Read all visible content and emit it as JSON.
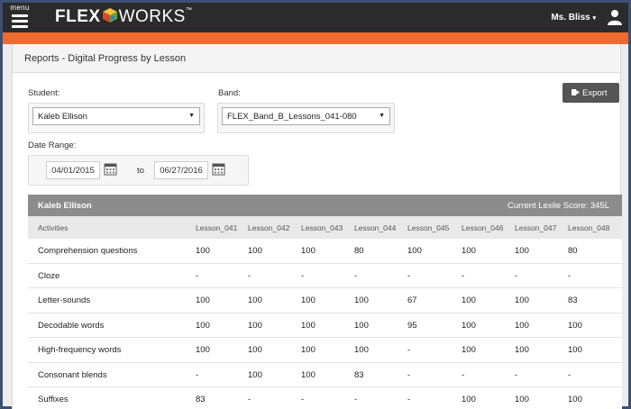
{
  "header": {
    "menu_label": "menu",
    "logo_flex": "FLEX",
    "logo_works": "WORKS",
    "logo_tm": "™",
    "user_name": "Ms. Bliss",
    "user_caret": "▾"
  },
  "page": {
    "title": "Reports - Digital Progress by Lesson"
  },
  "filters": {
    "student_label": "Student:",
    "student_value": "Kaleb Ellison",
    "band_label": "Band:",
    "band_value": "FLEX_Band_B_Lessons_041-080",
    "date_range_label": "Date Range:",
    "start_date": "04/01/2015",
    "to_label": "to",
    "end_date": "06/27/2016",
    "dropdown_arrow": "▼"
  },
  "toolbar": {
    "export_label": "Export"
  },
  "report": {
    "student_name": "Kaleb Ellison",
    "lexile": "Current Lexile Score: 345L",
    "columns": [
      "Activities",
      "Lesson_041",
      "Lesson_042",
      "Lesson_043",
      "Lesson_044",
      "Lesson_045",
      "Lesson_046",
      "Lesson_047",
      "Lesson_048"
    ],
    "rows": [
      {
        "activity": "Comprehension questions",
        "values": [
          "100",
          "100",
          "100",
          "80",
          "100",
          "100",
          "100",
          "80"
        ]
      },
      {
        "activity": "Cloze",
        "values": [
          "-",
          "-",
          "-",
          "-",
          "-",
          "-",
          "-",
          "-"
        ]
      },
      {
        "activity": "Letter-sounds",
        "values": [
          "100",
          "100",
          "100",
          "100",
          "67",
          "100",
          "100",
          "83"
        ]
      },
      {
        "activity": "Decodable words",
        "values": [
          "100",
          "100",
          "100",
          "100",
          "95",
          "100",
          "100",
          "100"
        ]
      },
      {
        "activity": "High-frequency words",
        "values": [
          "100",
          "100",
          "100",
          "100",
          "-",
          "100",
          "100",
          "100"
        ]
      },
      {
        "activity": "Consonant blends",
        "values": [
          "-",
          "100",
          "100",
          "83",
          "-",
          "-",
          "-",
          "-"
        ]
      },
      {
        "activity": "Suffixes",
        "values": [
          "83",
          "-",
          "-",
          "-",
          "-",
          "100",
          "100",
          "100"
        ]
      }
    ]
  },
  "colors": {
    "topbar": "#2b2b2b",
    "accent": "#ee6b2d",
    "table_header": "#8c8c8c"
  }
}
